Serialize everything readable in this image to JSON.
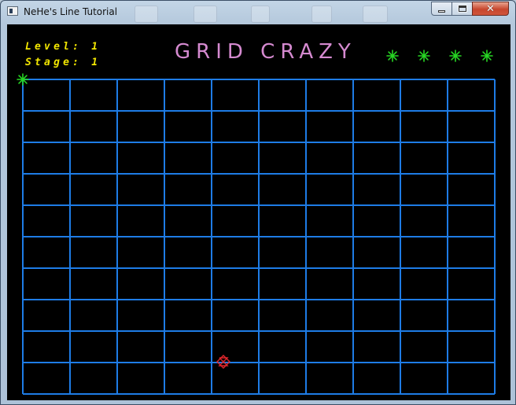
{
  "window": {
    "title": "NeHe's Line Tutorial",
    "close_glyph": "✕"
  },
  "hud": {
    "level_label": "Level:",
    "level_value": "1",
    "stage_label": "Stage:",
    "stage_value": "1",
    "lives_remaining": 4
  },
  "game": {
    "title": "GRID CRAZY",
    "grid_columns": 10,
    "grid_rows": 10,
    "player": {
      "column": 0,
      "row": 0,
      "icon": "green-asterisk-icon"
    },
    "enemy": {
      "icon": "red-diamond-hourglass-icon"
    }
  },
  "colors": {
    "grid_line": "#1e7ce6",
    "hud_text": "#f2e600",
    "title_text": "#d58ad0",
    "player": "#27d623",
    "enemy": "#e0262b",
    "background": "#000000"
  }
}
